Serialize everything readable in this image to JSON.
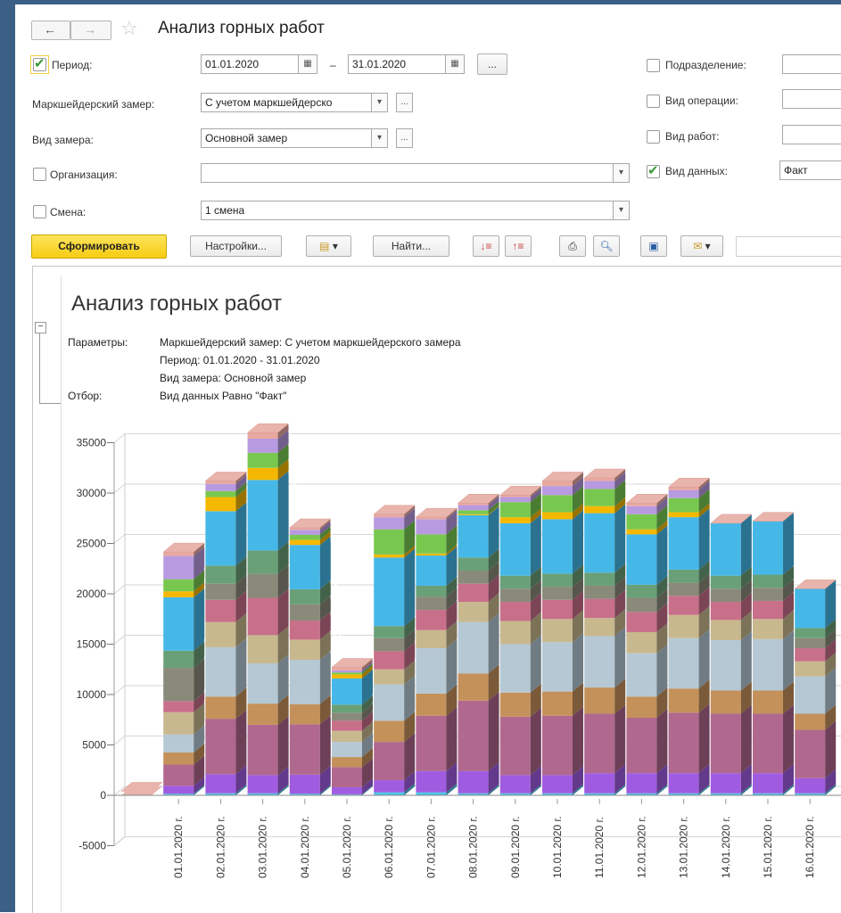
{
  "window": {
    "title": "Анализ горных работ"
  },
  "filters": {
    "period_label": "Период:",
    "date_from": "01.01.2020",
    "date_sep": "–",
    "date_to": "31.01.2020",
    "dots": "...",
    "survey_label": "Маркшейдерский замер:",
    "survey_value": "С учетом маркшейдерско",
    "measure_type_label": "Вид замера:",
    "measure_type_value": "Основной замер",
    "org_label": "Организация:",
    "org_value": "",
    "shift_label": "Смена:",
    "shift_value": "1 смена",
    "subdivision_label": "Подразделение:",
    "operation_label": "Вид операции:",
    "works_label": "Вид работ:",
    "data_type_label": "Вид данных:",
    "data_type_value": "Факт"
  },
  "toolbar": {
    "generate_label": "Сформировать",
    "settings_label": "Настройки...",
    "find_label": "Найти..."
  },
  "report": {
    "title": "Анализ горных работ",
    "params_label": "Параметры:",
    "param1": "Маркшейдерский замер: С учетом маркшейдерского замера",
    "param2": "Период: 01.01.2020 - 31.01.2020",
    "param3": "Вид замера: Основной замер",
    "filter_label": "Отбор:",
    "filter1": "Вид данных Равно \"Факт\""
  },
  "colors": {
    "accent_yellow": "#f6cc12",
    "frame_blue": "#3b5f86",
    "check_green": "#3a9a3a"
  },
  "chart_data": {
    "type": "bar",
    "stacked": true,
    "three_d": true,
    "ylim": [
      -5000,
      35000
    ],
    "yticks": [
      "35000",
      "30000",
      "25000",
      "20000",
      "15000",
      "10000",
      "5000",
      "0",
      "-5000"
    ],
    "categories": [
      "01.01.2020 г.",
      "02.01.2020 г.",
      "03.01.2020 г.",
      "04.01.2020 г.",
      "05.01.2020 г.",
      "06.01.2020 г.",
      "07.01.2020 г.",
      "08.01.2020 г.",
      "09.01.2020 г.",
      "10.01.2020 г.",
      "11.01.2020 г.",
      "12.01.2020 г.",
      "13.01.2020 г.",
      "14.01.2020 г.",
      "15.01.2020 г.",
      "16.01.2020 г."
    ],
    "totals": [
      500,
      22500,
      28500,
      34000,
      25700,
      12500,
      25700,
      28300,
      29800,
      30500,
      31500,
      31000,
      29500,
      31300,
      26600,
      26800,
      20600
    ],
    "series_colors": [
      "#4fc3e8",
      "#a05ce0",
      "#b0688e",
      "#c4915a",
      "#b5c8d4",
      "#c8b88e",
      "#c86f8a",
      "#8a8a7a",
      "#6aa078",
      "#45b8e8",
      "#f5b800",
      "#78c850",
      "#b89ae0",
      "#e8a8a0"
    ],
    "stacks": [
      [
        0,
        0,
        0,
        0,
        0,
        0,
        0,
        0,
        0,
        0,
        0,
        0,
        0,
        0
      ],
      [
        150,
        800,
        2100,
        1200,
        1800,
        2200,
        1100,
        3300,
        1700,
        5300,
        600,
        1200,
        2300,
        400
      ],
      [
        200,
        1900,
        5500,
        2200,
        4900,
        2500,
        2200,
        1600,
        1800,
        5400,
        1400,
        600,
        700,
        300
      ],
      [
        200,
        1800,
        5000,
        2100,
        4000,
        2800,
        3700,
        2400,
        2300,
        7000,
        1200,
        1500,
        1400,
        600
      ],
      [
        150,
        1900,
        5000,
        2000,
        4400,
        2000,
        1900,
        1600,
        1500,
        4400,
        500,
        500,
        500,
        200
      ],
      [
        100,
        700,
        2000,
        1000,
        1500,
        1100,
        1000,
        800,
        800,
        2600,
        400,
        200,
        200,
        300
      ],
      [
        300,
        1200,
        3800,
        2100,
        3600,
        1500,
        1800,
        1300,
        1200,
        6800,
        300,
        2500,
        1200,
        300
      ],
      [
        300,
        2100,
        5500,
        2200,
        4500,
        1800,
        2000,
        1300,
        1100,
        3000,
        200,
        1900,
        1500,
        200
      ],
      [
        200,
        2200,
        7000,
        2700,
        5100,
        2000,
        1800,
        1300,
        1300,
        4200,
        100,
        400,
        500,
        200
      ],
      [
        200,
        1800,
        5800,
        2400,
        4800,
        2300,
        1900,
        1300,
        1300,
        5200,
        600,
        1500,
        500,
        200
      ],
      [
        200,
        1800,
        5900,
        2400,
        4900,
        2300,
        1900,
        1300,
        1300,
        5400,
        700,
        1700,
        900,
        500
      ],
      [
        200,
        2000,
        5900,
        2600,
        5100,
        1800,
        1900,
        1300,
        1300,
        5900,
        700,
        1700,
        800,
        300
      ],
      [
        200,
        2000,
        5500,
        2100,
        4300,
        2100,
        2000,
        1400,
        1300,
        5000,
        500,
        1500,
        800,
        300
      ],
      [
        200,
        2000,
        6000,
        2400,
        5000,
        2300,
        1900,
        1300,
        1300,
        5200,
        500,
        1400,
        800,
        300
      ],
      [
        200,
        2000,
        5900,
        2300,
        5000,
        2000,
        1800,
        1300,
        1300,
        5200,
        0,
        0,
        0,
        0
      ],
      [
        200,
        2000,
        5900,
        2300,
        5100,
        2000,
        1800,
        1300,
        1300,
        5300,
        0,
        0,
        0,
        0
      ],
      [
        200,
        1500,
        4800,
        1600,
        3700,
        1500,
        1300,
        1000,
        1000,
        3900,
        0,
        0,
        0,
        0
      ]
    ]
  }
}
